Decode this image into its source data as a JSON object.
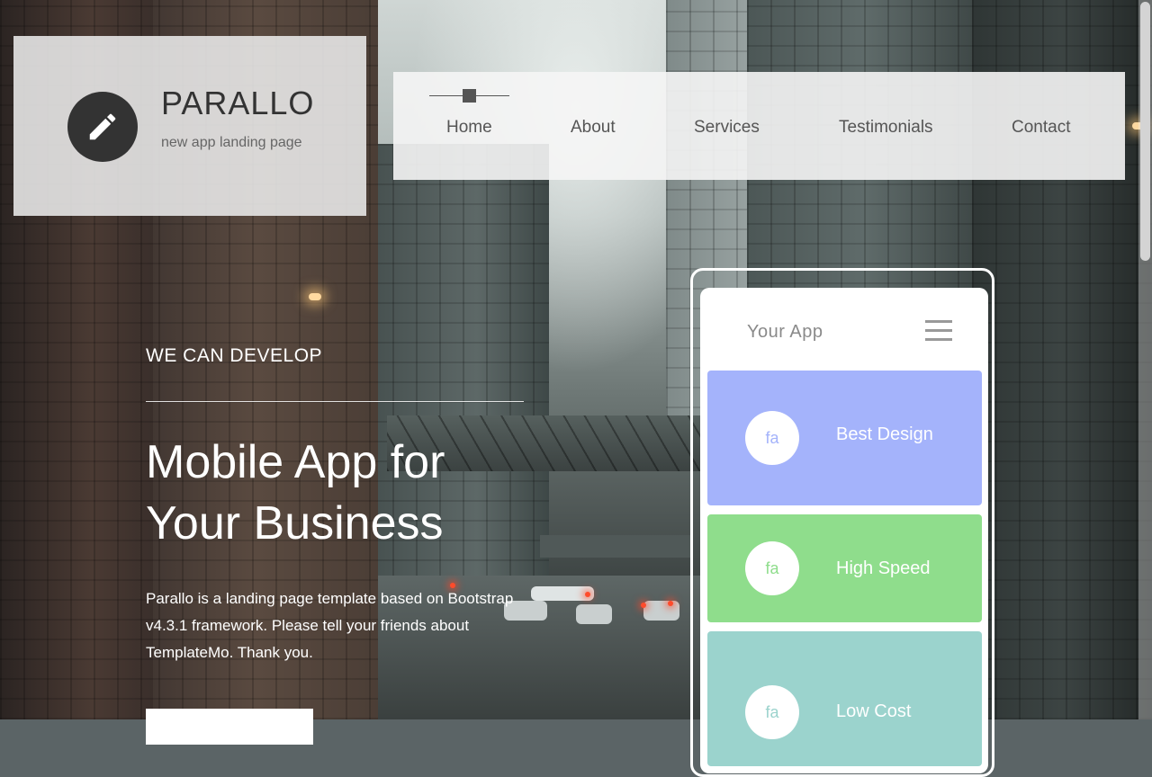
{
  "brand": {
    "title": "PARALLO",
    "subtitle": "new app landing page",
    "icon": "pencil-icon"
  },
  "nav": {
    "items": [
      {
        "label": "Home",
        "active": true
      },
      {
        "label": "About"
      },
      {
        "label": "Services"
      },
      {
        "label": "Testimonials"
      },
      {
        "label": "Contact"
      }
    ]
  },
  "hero": {
    "kicker": "WE CAN DEVELOP",
    "title_line1": "Mobile App for",
    "title_line2": "Your Business",
    "description": "Parallo is a landing page template based on Bootstrap v4.3.1 framework. Please tell your friends about TemplateMo. Thank you."
  },
  "phone": {
    "app_title": "Your App",
    "features": [
      {
        "icon_text": "fa",
        "label": "Best Design",
        "color": "#a4b3fb",
        "icon_color": "#a4b3fb"
      },
      {
        "icon_text": "fa",
        "label": "High Speed",
        "color": "#8fdd8c",
        "icon_color": "#8fdd8c"
      },
      {
        "icon_text": "fa",
        "label": "Low Cost",
        "color": "#9bd3cd",
        "icon_color": "#9bd3cd"
      }
    ]
  },
  "colors": {
    "brand_box_bg": "#ebebeb",
    "nav_bg": "#f5f5f5",
    "logo_circle": "#333333",
    "text_dark": "#333333"
  }
}
